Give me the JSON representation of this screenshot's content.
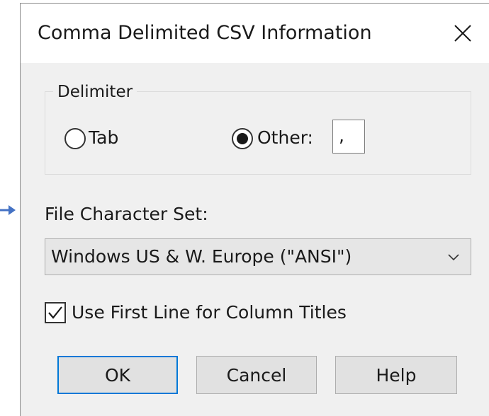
{
  "window": {
    "title": "Comma Delimited CSV Information",
    "close_icon": "close-icon"
  },
  "delimiter": {
    "legend": "Delimiter",
    "options": [
      {
        "label": "Tab",
        "selected": false
      },
      {
        "label": "Other:",
        "selected": true
      }
    ],
    "other_value": ","
  },
  "charset": {
    "label": "File Character Set:",
    "selected": "Windows US & W. Europe (\"ANSI\")"
  },
  "first_line_titles": {
    "label": "Use First Line for Column Titles",
    "checked": true
  },
  "buttons": {
    "ok": "OK",
    "cancel": "Cancel",
    "help": "Help"
  },
  "colors": {
    "dialog_bg": "#f0f0f0",
    "accent": "#0078d7",
    "annotation_arrow": "#4472c4"
  }
}
